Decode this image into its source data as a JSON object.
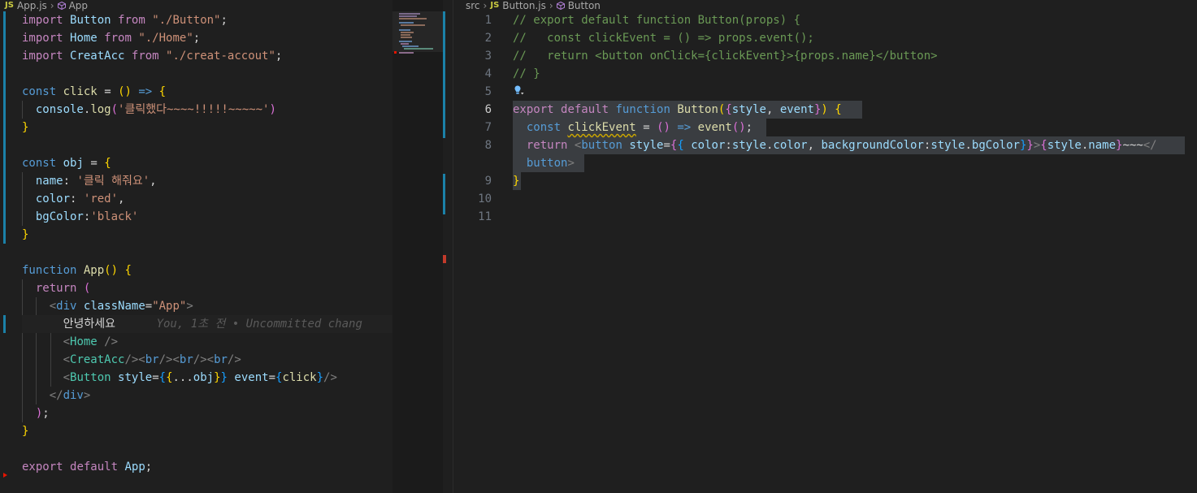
{
  "left_editor": {
    "breadcrumb": {
      "icon": "javascript-file-icon",
      "js_badge": "JS",
      "file": "App.js",
      "symbol": "App"
    },
    "blame_text": "You, 1초 전 • Uncommitted chang",
    "lines": [
      "import Button from \"./Button\";",
      "import Home from \"./Home\";",
      "import CreatAcc from \"./creat-accout\";",
      "",
      "const click = () => {",
      "  console.log('클릭했다~~~~!!!!!~~~~~')",
      "}",
      "",
      "const obj = {",
      "  name: '클릭 해줘요',",
      "  color: 'red',",
      "  bgColor:'black'",
      "}",
      "",
      "function App() {",
      "  return (",
      "    <div className=\"App\">",
      "      안녕하세요",
      "      <Home />",
      "      <CreatAcc/><br/><br/><br/>",
      "      <Button style={{...obj}} event={click}/>",
      "    </div>",
      "  );",
      "}",
      "",
      "export default App;"
    ]
  },
  "right_editor": {
    "breadcrumb": {
      "folder": "src",
      "js_badge": "JS",
      "file": "Button.js",
      "symbol": "Button"
    },
    "line_numbers": [
      "1",
      "2",
      "3",
      "4",
      "5",
      "6",
      "7",
      "8",
      "",
      "9",
      "10",
      "11"
    ],
    "lines": [
      "// export default function Button(props) {",
      "//   const clickEvent = () => props.event();",
      "//   return <button onClick={clickEvent}>{props.name}</button>",
      "// }",
      "",
      "export default function Button({style, event}) {",
      "  const clickEvent = () => event();",
      "  return <button style={{ color:style.color, backgroundColor:style.bgColor}}>{style.name}~~~</",
      "  button>",
      "}",
      "",
      ""
    ]
  },
  "colors": {
    "background": "#1f1f1f",
    "keyword": "#569cd6",
    "control": "#c586c0",
    "function": "#dcdcaa",
    "variable": "#9cdcfe",
    "string": "#ce9178",
    "comment": "#6a9955",
    "selection": "#3a3d41",
    "git_modified": "#1b81a8"
  }
}
